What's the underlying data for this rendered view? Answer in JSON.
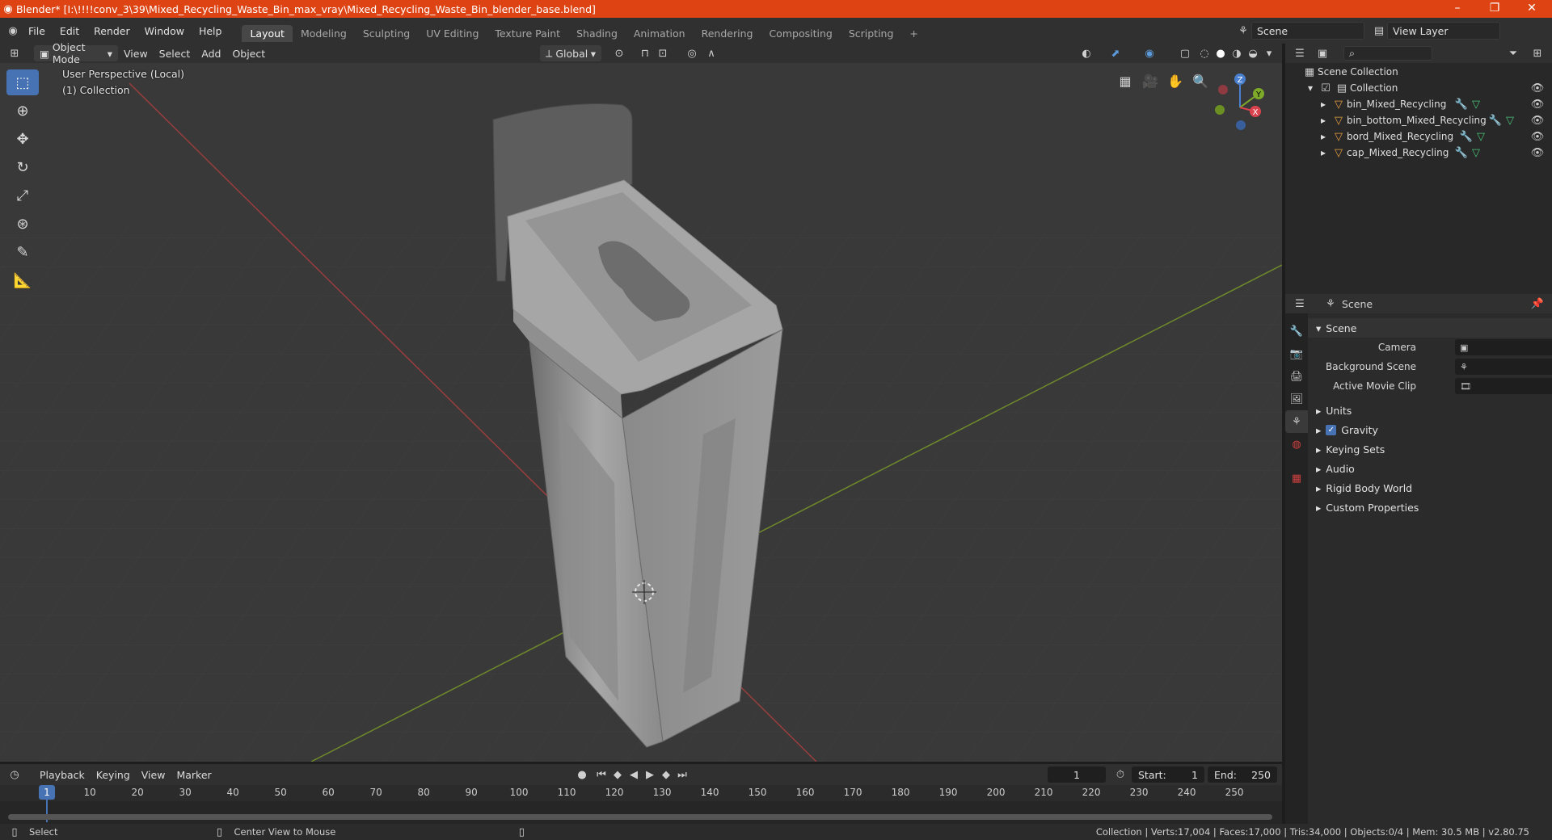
{
  "window": {
    "title": "Blender* [I:\\!!!!conv_3\\39\\Mixed_Recycling_Waste_Bin_max_vray\\Mixed_Recycling_Waste_Bin_blender_base.blend]",
    "minimize": "–",
    "maximize": "❐",
    "close": "✕"
  },
  "menu": [
    "File",
    "Edit",
    "Render",
    "Window",
    "Help"
  ],
  "workspaces": [
    "Layout",
    "Modeling",
    "Sculpting",
    "UV Editing",
    "Texture Paint",
    "Shading",
    "Animation",
    "Rendering",
    "Compositing",
    "Scripting"
  ],
  "scene_selector": "Scene",
  "view_layer": "View Layer",
  "viewport_header": {
    "mode": "Object Mode",
    "menus": [
      "View",
      "Select",
      "Add",
      "Object"
    ],
    "transform_orientation": "Global"
  },
  "viewport": {
    "perspective_label": "User Perspective (Local)",
    "collection_label": "(1) Collection",
    "gizmo": {
      "x": "X",
      "y": "Y",
      "z": "Z"
    }
  },
  "outliner": {
    "root": "Scene Collection",
    "collection": "Collection",
    "objects": [
      "bin_Mixed_Recycling",
      "bin_bottom_Mixed_Recycling",
      "bord_Mixed_Recycling",
      "cap_Mixed_Recycling"
    ]
  },
  "properties": {
    "context": "Scene",
    "panel": "Scene",
    "camera_label": "Camera",
    "background_scene_label": "Background Scene",
    "active_movie_clip_label": "Active Movie Clip",
    "sections": [
      "Units",
      "Gravity",
      "Keying Sets",
      "Audio",
      "Rigid Body World",
      "Custom Properties"
    ]
  },
  "timeline": {
    "menus": [
      "Playback",
      "Keying",
      "View",
      "Marker"
    ],
    "current_frame": "1",
    "start_label": "Start:",
    "start": "1",
    "end_label": "End:",
    "end": "250",
    "ruler": [
      "1",
      "10",
      "20",
      "30",
      "40",
      "50",
      "60",
      "70",
      "80",
      "90",
      "100",
      "110",
      "120",
      "130",
      "140",
      "150",
      "160",
      "170",
      "180",
      "190",
      "200",
      "210",
      "220",
      "230",
      "240",
      "250"
    ]
  },
  "status": {
    "left": "Select",
    "middle": "Center View to Mouse",
    "right": "Collection | Verts:17,004 | Faces:17,000 | Tris:34,000 | Objects:0/4 | Mem: 30.5 MB | v2.80.75"
  }
}
